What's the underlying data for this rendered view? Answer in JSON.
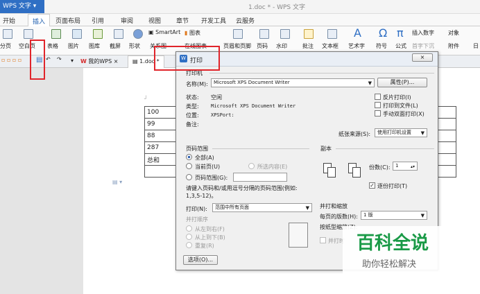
{
  "app": {
    "name": "WPS 文字",
    "doc_title": "1.doc * - WPS 文字"
  },
  "menu": [
    "开始",
    "插入",
    "页面布局",
    "引用",
    "审阅",
    "视图",
    "章节",
    "开发工具",
    "云服务"
  ],
  "active_menu": "插入",
  "ribbon": {
    "page_sep": "分页",
    "blank_page": "空白页",
    "table": "表格",
    "picture": "图片",
    "gallery": "图库",
    "screenshot": "截屏",
    "shape": "形状",
    "relation": "关系图",
    "smartart": "SmartArt",
    "chart": "图表",
    "online_chart": "在线图表",
    "header_footer": "页眉和页脚",
    "page_num": "页码",
    "watermark": "水印",
    "comment": "批注",
    "textbox": "文本框",
    "wordart": "艺术字",
    "symbol": "符号",
    "formula": "公式",
    "insert_number": "插入数字",
    "first_drop": "首字下沉",
    "object": "对象",
    "attachment": "附件",
    "date": "日"
  },
  "tabs": {
    "my_wps": "我的WPS",
    "doc": "1.doc *"
  },
  "doc_table": {
    "rows": [
      "100",
      "99",
      "88",
      "287",
      "总和",
      ""
    ]
  },
  "dialog": {
    "title": "打印",
    "printer_section": "打印机",
    "name_label": "名称(M):",
    "printer_name": "Microsoft XPS Document Writer",
    "props_btn": "属性(P)...",
    "status_label": "状态:",
    "status_val": "空闲",
    "type_label": "类型:",
    "type_val": "Microsoft XPS Document Writer",
    "where_label": "位置:",
    "where_val": "XPSPort:",
    "comment_label": "备注:",
    "reverse": "反片打印(I)",
    "to_file": "打印到文件(L)",
    "duplex": "手动双面打印(X)",
    "paper_source_label": "纸张来源(S):",
    "paper_source": "使用打印机设置",
    "range_section": "页码范围",
    "all": "全部(A)",
    "current": "当前页(U)",
    "selection": "所选内容(E)",
    "pages": "页码范围(G):",
    "pages_hint": "请键入页码和/或用逗号分隔的页码范围(例如:",
    "pages_hint2": "1,3,5-12)。",
    "copies_section": "副本",
    "copies_label": "份数(C):",
    "copies_val": "1",
    "collate": "逐份打印(T)",
    "print_label": "打印(N):",
    "print_val": "范围中所有页面",
    "order_section": "并打顺序",
    "order1": "从左到右(F)",
    "order2": "从上到下(B)",
    "order3": "重复(R)",
    "zoom_section": "并打和缩放",
    "per_page_label": "每页的版数(H):",
    "per_page_val": "1 版",
    "paper_size_label": "按纸型缩放(Z):",
    "parallel": "并打时",
    "options_btn": "选项(O)...",
    "close": "×"
  },
  "watermark": {
    "main": "百科全说",
    "sub": "助你轻松解决"
  }
}
